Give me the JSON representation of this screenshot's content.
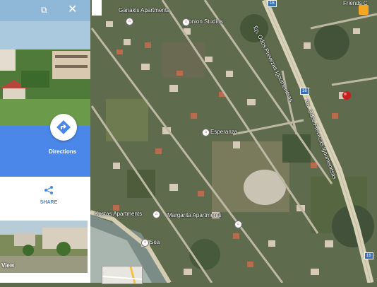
{
  "map": {
    "labels": {
      "ganakis": "Ganakis Apartments",
      "ionion": "Ionion Studios",
      "esperanza": "Esperanza",
      "kostas": "Kostas Apartments",
      "margarita": "Margarita Apartments",
      "sea": "Sea",
      "road_upper": "Ep. Odos Prevezas Igoumenitsas",
      "road_lower": "Ep. Odos Prevezas Igoumenitsas",
      "friends": "Friends C",
      "route_16a": "16",
      "route_16b": "16",
      "route_16c": "16"
    },
    "colors": {
      "road": "#d8d2b8",
      "pin": "#c81e1e",
      "accent": "#4a87e8"
    }
  },
  "panel": {
    "directions_label": "Directions",
    "share_label": "SHARE",
    "view_label": "View",
    "icons": {
      "close": "close-icon",
      "expand": "expand-photo-icon",
      "directions": "directions-icon",
      "share": "share-icon"
    }
  }
}
